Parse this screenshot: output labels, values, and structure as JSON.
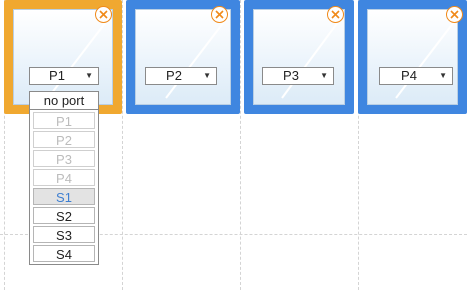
{
  "slots": [
    {
      "port_value": "P1",
      "state": "active"
    },
    {
      "port_value": "P2",
      "state": "normal"
    },
    {
      "port_value": "P3",
      "state": "normal"
    },
    {
      "port_value": "P4",
      "state": "normal"
    }
  ],
  "dropdown": {
    "options": [
      {
        "label": "no port",
        "status": "enabled"
      },
      {
        "label": "P1",
        "status": "disabled"
      },
      {
        "label": "P2",
        "status": "disabled"
      },
      {
        "label": "P3",
        "status": "disabled"
      },
      {
        "label": "P4",
        "status": "disabled"
      },
      {
        "label": "S1",
        "status": "selected"
      },
      {
        "label": "S2",
        "status": "enabled"
      },
      {
        "label": "S3",
        "status": "enabled"
      },
      {
        "label": "S4",
        "status": "enabled"
      }
    ]
  },
  "colors": {
    "active_border": "#f0a830",
    "slot_border": "#3f86e0",
    "close_icon": "#f08a1a",
    "selected_text": "#3e7fd1"
  }
}
